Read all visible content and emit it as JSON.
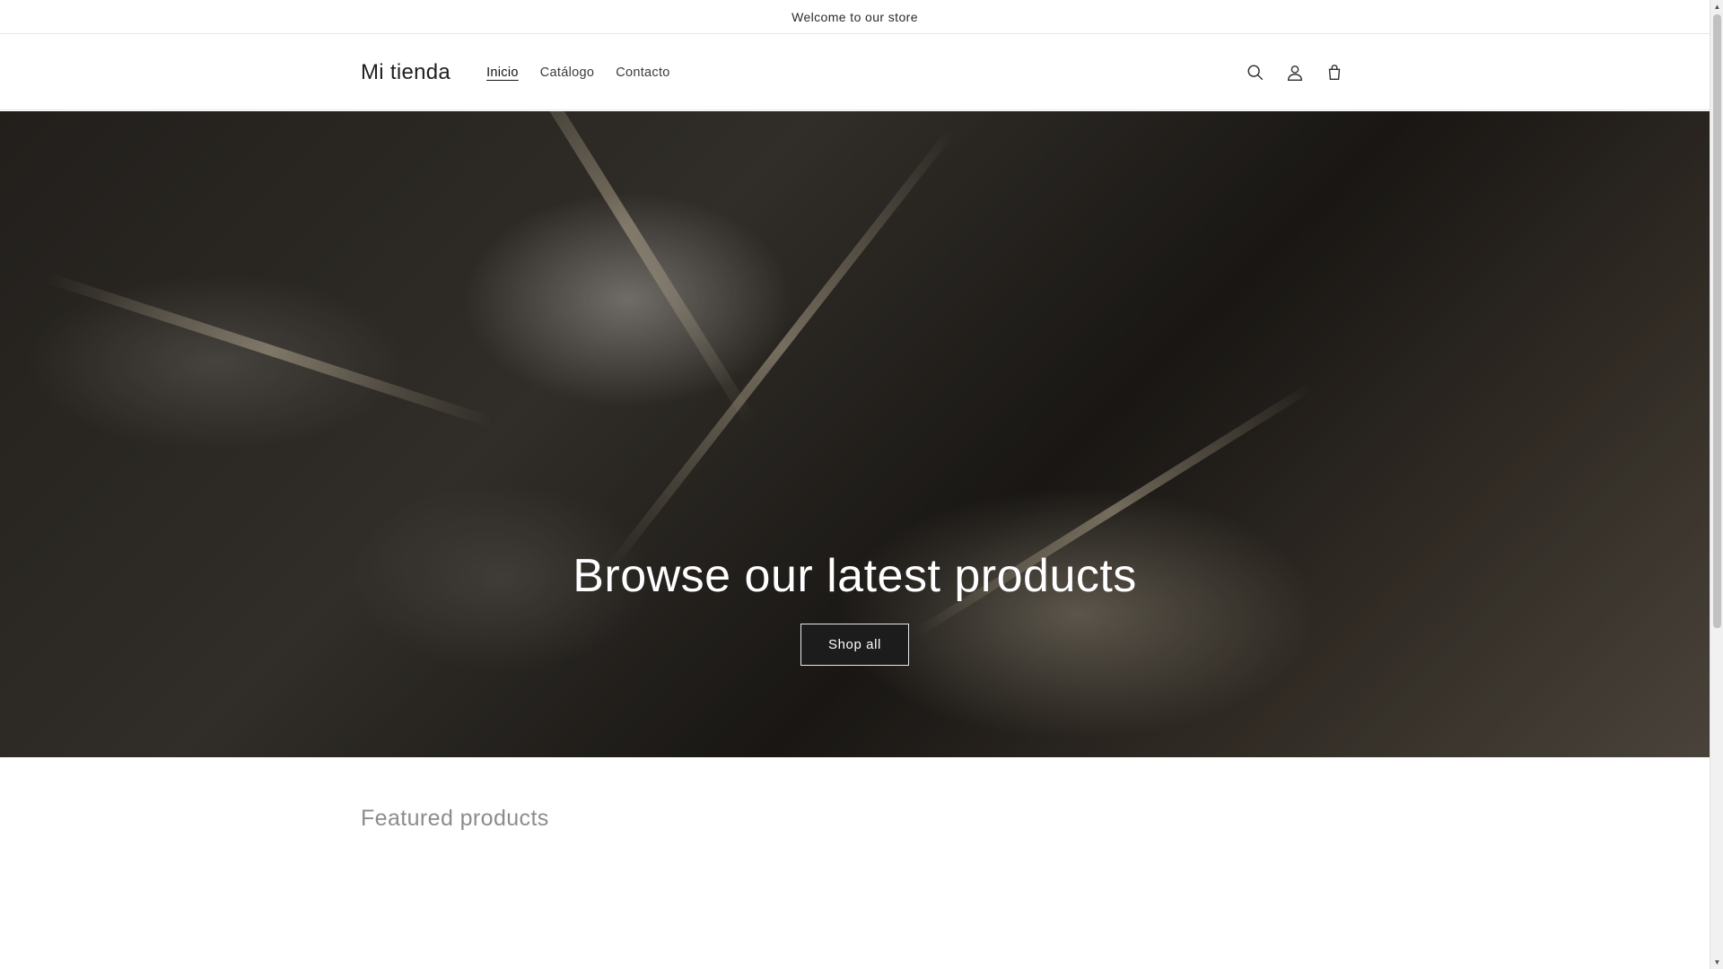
{
  "announcement": {
    "text": "Welcome to our store"
  },
  "header": {
    "logo": "Mi tienda",
    "nav": [
      {
        "label": "Inicio",
        "active": true
      },
      {
        "label": "Catálogo",
        "active": false
      },
      {
        "label": "Contacto",
        "active": false
      }
    ],
    "icons": [
      "search-icon",
      "account-icon",
      "cart-icon"
    ]
  },
  "hero": {
    "title": "Browse our latest products",
    "button_label": "Shop all"
  },
  "featured": {
    "title": "Featured products"
  },
  "colors": {
    "text": "#121212",
    "muted": "#8c8c8c",
    "hero_button_bg": "#1c1c1c"
  },
  "scrollbar": {
    "up_glyph": "▲",
    "down_glyph": "▼"
  }
}
